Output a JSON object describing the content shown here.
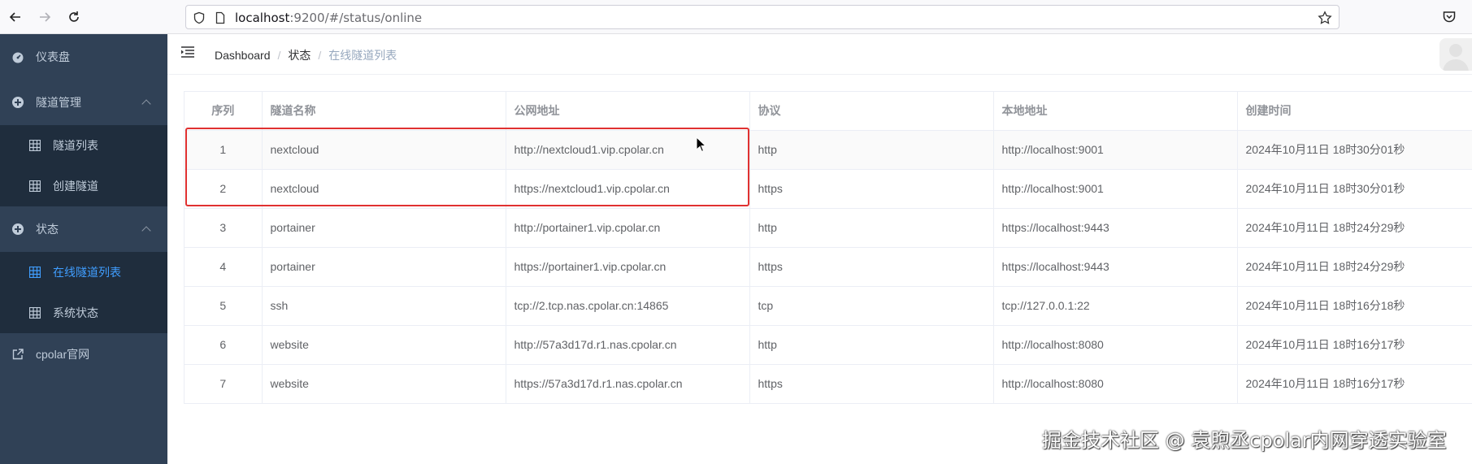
{
  "browser": {
    "url_host": "localhost",
    "url_rest": ":9200/#/status/online"
  },
  "sidebar": {
    "items": [
      {
        "label": "仪表盘",
        "icon": "dashboard-icon"
      },
      {
        "label": "隧道管理",
        "icon": "tunnel-manage-icon",
        "expanded": true,
        "children": [
          {
            "label": "隧道列表",
            "icon": "grid-icon"
          },
          {
            "label": "创建隧道",
            "icon": "grid-icon"
          }
        ]
      },
      {
        "label": "状态",
        "icon": "status-icon",
        "expanded": true,
        "children": [
          {
            "label": "在线隧道列表",
            "icon": "grid-icon",
            "active": true
          },
          {
            "label": "系统状态",
            "icon": "grid-icon"
          }
        ]
      },
      {
        "label": "cpolar官网",
        "icon": "external-link-icon"
      }
    ]
  },
  "breadcrumb": {
    "home": "Dashboard",
    "section": "状态",
    "current": "在线隧道列表"
  },
  "table": {
    "columns": [
      "序列",
      "隧道名称",
      "公网地址",
      "协议",
      "本地地址",
      "创建时间"
    ],
    "rows": [
      [
        "1",
        "nextcloud",
        "http://nextcloud1.vip.cpolar.cn",
        "http",
        "http://localhost:9001",
        "2024年10月11日 18时30分01秒"
      ],
      [
        "2",
        "nextcloud",
        "https://nextcloud1.vip.cpolar.cn",
        "https",
        "http://localhost:9001",
        "2024年10月11日 18时30分01秒"
      ],
      [
        "3",
        "portainer",
        "http://portainer1.vip.cpolar.cn",
        "http",
        "https://localhost:9443",
        "2024年10月11日 18时24分29秒"
      ],
      [
        "4",
        "portainer",
        "https://portainer1.vip.cpolar.cn",
        "https",
        "https://localhost:9443",
        "2024年10月11日 18时24分29秒"
      ],
      [
        "5",
        "ssh",
        "tcp://2.tcp.nas.cpolar.cn:14865",
        "tcp",
        "tcp://127.0.0.1:22",
        "2024年10月11日 18时16分18秒"
      ],
      [
        "6",
        "website",
        "http://57a3d17d.r1.nas.cpolar.cn",
        "http",
        "http://localhost:8080",
        "2024年10月11日 18时16分17秒"
      ],
      [
        "7",
        "website",
        "https://57a3d17d.r1.nas.cpolar.cn",
        "https",
        "http://localhost:8080",
        "2024年10月11日 18时16分17秒"
      ]
    ]
  },
  "watermark": "掘金技术社区 @ 袁煦丞cpolar内网穿透实验室",
  "colors": {
    "sidebar_bg": "#304156",
    "submenu_bg": "#1f2d3d",
    "active": "#409eff",
    "highlight": "#e03131"
  }
}
